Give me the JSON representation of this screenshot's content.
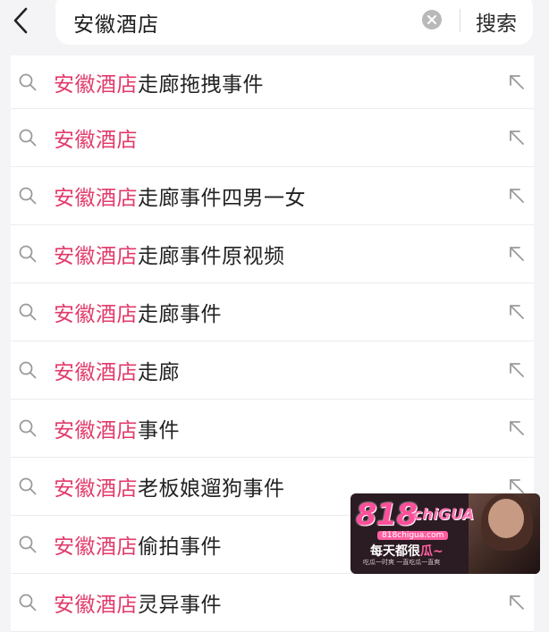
{
  "header": {
    "query": "安徽酒店",
    "search_label": "搜索"
  },
  "suggestions": [
    {
      "highlight": "安徽酒店",
      "rest": "走廊拖拽事件"
    },
    {
      "highlight": "安徽酒店",
      "rest": ""
    },
    {
      "highlight": "安徽酒店",
      "rest": "走廊事件四男一女"
    },
    {
      "highlight": "安徽酒店",
      "rest": "走廊事件原视频"
    },
    {
      "highlight": "安徽酒店",
      "rest": "走廊事件"
    },
    {
      "highlight": "安徽酒店",
      "rest": "走廊"
    },
    {
      "highlight": "安徽酒店",
      "rest": "事件"
    },
    {
      "highlight": "安徽酒店",
      "rest": "老板娘遛狗事件"
    },
    {
      "highlight": "安徽酒店",
      "rest": "偷拍事件"
    },
    {
      "highlight": "安徽酒店",
      "rest": "灵异事件"
    }
  ],
  "watermark": {
    "logo": "818",
    "logo_suffix": "chiGUA",
    "domain": "818chigua.com",
    "slogan": "每天都很",
    "slogan_hl": "瓜~",
    "subtext": "吃瓜一时爽 一直吃瓜一直爽"
  },
  "colors": {
    "highlight": "#e23a6a",
    "background": "#f4f4f6",
    "text": "#222222"
  },
  "icons": {
    "back": "chevron-left-icon",
    "clear": "clear-circle-icon",
    "row": "search-icon",
    "fill": "arrow-up-left-icon"
  }
}
